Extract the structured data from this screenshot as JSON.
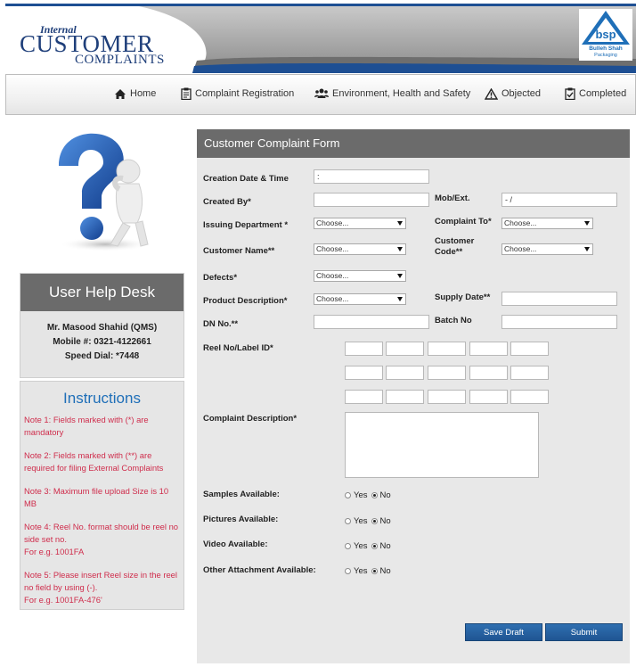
{
  "header": {
    "brand_internal": "Internal",
    "brand_customer": "CUSTOMER",
    "brand_complaints": "COMPLAINTS",
    "logo_name": "Bulleh Shah",
    "logo_sub": "Packaging",
    "logo_icon": "bsp-triangle-logo",
    "accent_color": "#1e4f93"
  },
  "nav": [
    {
      "label": "Home",
      "icon": "home-icon"
    },
    {
      "label": "Complaint Registration",
      "icon": "clipboard-icon"
    },
    {
      "label": "Environment, Health and Safety",
      "icon": "people-icon"
    },
    {
      "label": "Objected",
      "icon": "warning-icon"
    },
    {
      "label": "Completed",
      "icon": "checked-clipboard-icon"
    }
  ],
  "helpdesk": {
    "title": "User Help Desk",
    "contact_name": "Mr. Masood Shahid (QMS)",
    "mobile": "Mobile #: 0321-4122661",
    "speed_dial": "Speed Dial: *7448"
  },
  "instructions": {
    "title": "Instructions",
    "notes": [
      "Note 1: Fields marked with (*) are mandatory",
      "Note 2: Fields marked with (**) are required for filing External Complaints",
      "Note 3: Maximum file upload Size is 10 MB",
      "Note 4: Reel No. format should be reel no side set no.\nFor e.g. 1001FA",
      "Note 5: Please insert Reel size in the reel no field by using (-).\nFor e.g. 1001FA-476'"
    ],
    "note_color": "#cf2d4c"
  },
  "form": {
    "title": "Customer Complaint Form",
    "creation_label": "Creation Date & Time",
    "creation_value": ":",
    "created_by_label": "Created By*",
    "created_by_value": "",
    "mob_label": "Mob/Ext.",
    "mob_value": "- /",
    "issuing_dept_label": "Issuing Department *",
    "issuing_dept_value": "Choose...",
    "complaint_to_label": "Complaint To*",
    "complaint_to_value": "Choose...",
    "customer_name_label": "Customer Name**",
    "customer_name_value": "Choose...",
    "customer_code_label": "Customer Code**",
    "customer_code_value": "Choose...",
    "defects_label": "Defects*",
    "defects_value": "Choose...",
    "product_desc_label": "Product Description*",
    "product_desc_value": "Choose...",
    "supply_date_label": "Supply Date**",
    "supply_date_value": "",
    "dn_no_label": "DN No.**",
    "dn_no_value": "",
    "batch_no_label": "Batch No",
    "batch_no_value": "",
    "reel_label": "Reel No/Label ID*",
    "complaint_desc_label": "Complaint Description*",
    "complaint_desc_value": "",
    "availability": [
      {
        "label": "Samples Available:",
        "yes": "Yes",
        "no": "No",
        "selected": "No"
      },
      {
        "label": "Pictures Available:",
        "yes": "Yes",
        "no": "No",
        "selected": "No"
      },
      {
        "label": "Video Available:",
        "yes": "Yes",
        "no": "No",
        "selected": "No"
      },
      {
        "label": "Other Attachment Available:",
        "yes": "Yes",
        "no": "No",
        "selected": "No"
      }
    ],
    "save_draft": "Save Draft",
    "submit": "Submit",
    "button_color": "#1f5593"
  }
}
